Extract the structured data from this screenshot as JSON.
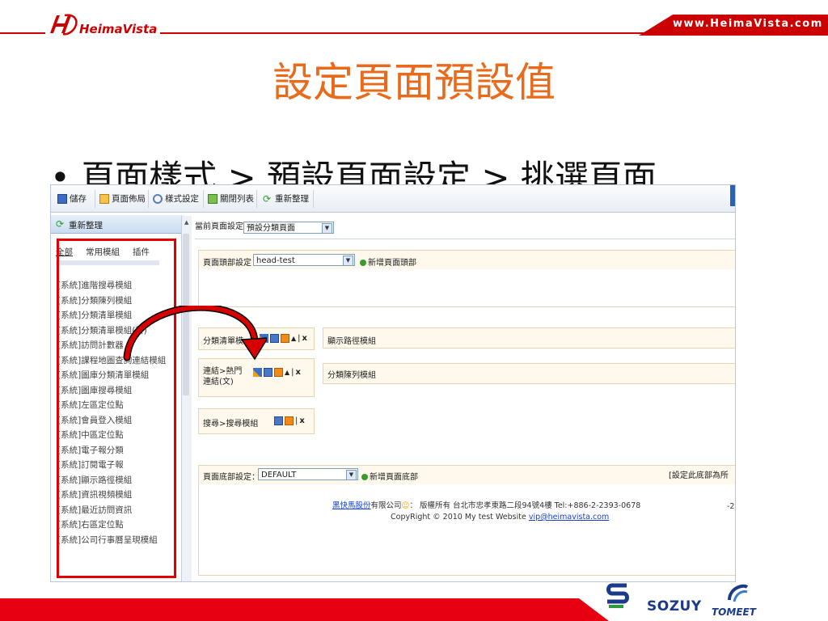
{
  "header": {
    "logo_text": "HeimaVista",
    "site_url": "www.HeimaVista.com"
  },
  "slide": {
    "title": "設定頁面預設值",
    "bullet": "• 頁面樣式 > 預設頁面設定 > 挑選頁面"
  },
  "toolbar": {
    "save": "儲存",
    "layout": "頁面佈局",
    "style": "樣式設定",
    "close_list": "關閉列表",
    "refresh": "重新整理"
  },
  "left_panel": {
    "refresh": "重新整理",
    "tabs": [
      "全部",
      "常用模組",
      "插件"
    ],
    "modules": [
      "[系統]進階搜尋模組",
      "[系統]分類陳列模組",
      "[系統]分類清單模組",
      "[系統]分類清單模組(新)",
      "[系統]訪問計數器",
      "[系統]課程地圖查詢連結模組",
      "[系統]圖庫分類清單模組",
      "[系統]圖庫搜尋模組",
      "[系統]左區定位點",
      "[系統]會員登入模組",
      "[系統]中區定位點",
      "[系統]電子報分類",
      "[系統]訂閱電子報",
      "[系統]顯示路徑模組",
      "[系統]資訊視頻模組",
      "[系統]最近訪問資訊",
      "[系統]右區定位點",
      "[系統]公司行事曆呈現模組"
    ]
  },
  "main_panel": {
    "current_setting_label": "當前頁面設定：",
    "current_setting_value": "預設分類頁面",
    "header_setting_label": "頁面頭部設定",
    "header_setting_value": "head-test",
    "add_header": "新增頁面頭部",
    "modules_left": [
      {
        "label": "分類清單模"
      },
      {
        "label": "連結>熱門連結(文)"
      },
      {
        "label": "搜尋>搜尋模組"
      }
    ],
    "modules_right": [
      "顯示路徑模組",
      "分類陳列模組"
    ],
    "close_glyph": "x",
    "up_glyph": "▲",
    "footer_setting_label": "頁面底部設定：",
    "footer_setting_value": "DEFAULT",
    "add_footer": "新增頁面底部",
    "footer_right_note": "[設定此底部為所",
    "footer_company_link": "黑快馬股份",
    "footer_company_rest": "有限公司",
    "footer_rights": "： 版權所有 台北市忠孝東路二段94號4樓 Tel:+886-2-2393-0678",
    "footer_copyright": "CopyRight © 2010 My test Website",
    "footer_email": "vip@heimavista.com",
    "footer_right_partial": "-2"
  },
  "bottom_logos": {
    "soruy": "SOZUY",
    "tomeet": "TOMEET"
  },
  "colors": {
    "brand_red": "#e60012",
    "title_orange": "#e86a1a",
    "highlight_red": "#e20000"
  }
}
